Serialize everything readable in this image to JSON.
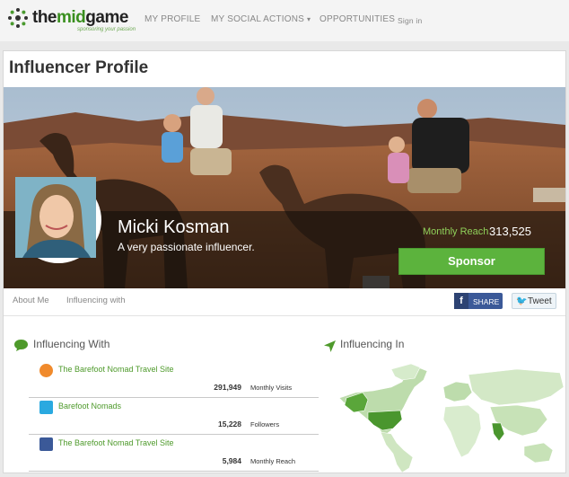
{
  "brand": {
    "name_a": "the",
    "name_b": "mid",
    "name_c": "game",
    "tagline": "sponsoring your passion"
  },
  "nav": {
    "profile": "MY PROFILE",
    "social": "MY SOCIAL ACTIONS",
    "social_arrow": "▾",
    "opportunities": "OPPORTUNITIES",
    "signin": "Sign in"
  },
  "page": {
    "title": "Influencer Profile"
  },
  "profile": {
    "name": "Micki Kosman",
    "tagline": "A very passionate influencer.",
    "reach_label": "Monthly Reach",
    "reach_value": "313,525",
    "sponsor_label": "Sponsor"
  },
  "tabs": {
    "about": "About Me",
    "influencing": "Influencing with"
  },
  "social_buttons": {
    "share_icon": "f",
    "share": "SHARE",
    "tweet_icon": "🐦",
    "tweet": "Tweet"
  },
  "influencing_with": {
    "title": "Influencing With",
    "icon": "speech-bubble-icon",
    "items": [
      {
        "name": "The Barefoot Nomad Travel Site",
        "value": "291,949",
        "unit": "Monthly Visits",
        "icon": "blog-icon",
        "color": "#f08a2c"
      },
      {
        "name": "Barefoot Nomads",
        "value": "15,228",
        "unit": "Followers",
        "icon": "twitter-icon",
        "color": "#2aa9e0"
      },
      {
        "name": "The Barefoot Nomad Travel Site",
        "value": "5,984",
        "unit": "Monthly Reach",
        "icon": "facebook-icon",
        "color": "#3b5998"
      }
    ]
  },
  "influencing_in": {
    "title": "Influencing In",
    "icon": "location-arrow-icon"
  },
  "colors": {
    "accent": "#5cb33d",
    "link": "#4e9a2b",
    "reach": "#8fd05a"
  }
}
